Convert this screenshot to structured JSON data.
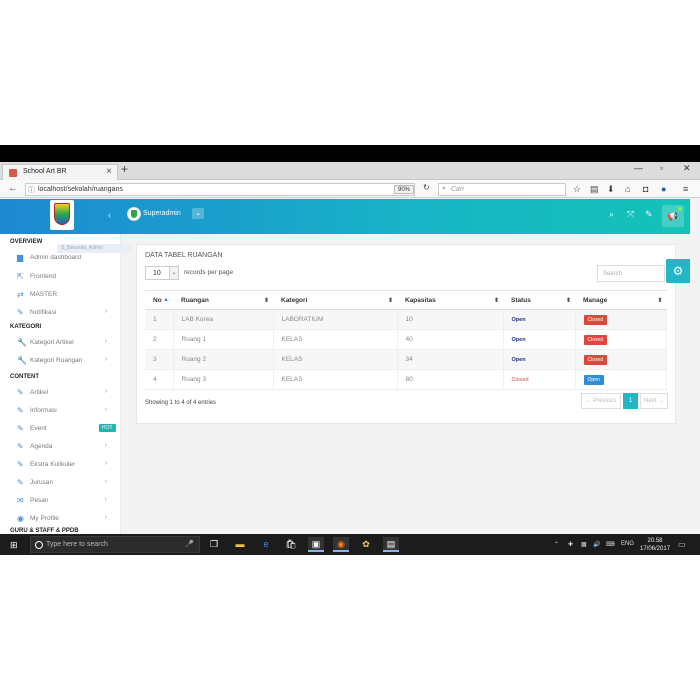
{
  "browser": {
    "tab_title": "School Art BR",
    "tab_close": "×",
    "new_tab": "+",
    "url": "localhost/sekolah/ruangans",
    "zoom": "90%",
    "search_placeholder": "Cari",
    "win_min": "—",
    "win_max": "▫",
    "win_close": "✕"
  },
  "header": {
    "user_name": "Superadmin",
    "collapse_icon": "‹",
    "dropdown_icon": "⌄"
  },
  "sidebar": {
    "ghost_label": "S_Beranda_Admin",
    "sections": [
      {
        "title": "OVERVIEW"
      },
      {
        "title": "KATEGORI"
      },
      {
        "title": "CONTENT"
      },
      {
        "title": "GURU & STAFF & PPDB"
      }
    ],
    "items": [
      {
        "label": "Admin dashboard",
        "icon": "chart-icon",
        "chev": ""
      },
      {
        "label": "Frontend",
        "icon": "external-link-icon",
        "chev": ""
      },
      {
        "label": "MASTER",
        "icon": "arrows-icon",
        "chev": ""
      },
      {
        "label": "Notifikasi",
        "icon": "pencil-icon",
        "chev": "›"
      },
      {
        "label": "Kategori Artikel",
        "icon": "wrench-icon",
        "chev": "›"
      },
      {
        "label": "Kategori Ruangan",
        "icon": "wrench-icon",
        "chev": "›"
      },
      {
        "label": "Artikel",
        "icon": "pencil-icon",
        "chev": "›"
      },
      {
        "label": "Informasi",
        "icon": "pencil-icon",
        "chev": "›"
      },
      {
        "label": "Event",
        "icon": "pencil-icon",
        "chev": "›",
        "badge": "HOT"
      },
      {
        "label": "Agenda",
        "icon": "pencil-icon",
        "chev": "›"
      },
      {
        "label": "Ekstra Kulikuler",
        "icon": "pencil-icon",
        "chev": "›"
      },
      {
        "label": "Jurusan",
        "icon": "pencil-icon",
        "chev": "›"
      },
      {
        "label": "Pesan",
        "icon": "mail-icon",
        "chev": "›"
      },
      {
        "label": "My Profile",
        "icon": "eye-icon",
        "chev": "›"
      }
    ]
  },
  "main": {
    "title": "DATA TABEL RUANGAN",
    "page_length": "10",
    "page_length_suffix": "records per page",
    "search_placeholder": "Search",
    "columns": [
      "No",
      "Ruangan",
      "Kategori",
      "Kapasitas",
      "Status",
      "Manage"
    ],
    "rows": [
      {
        "no": "1",
        "ruangan": "LAB Korea",
        "kategori": "LABORATIUM",
        "kapasitas": "10",
        "status": "Open",
        "manage": "Closed"
      },
      {
        "no": "2",
        "ruangan": "Ruang 1",
        "kategori": "KELAS",
        "kapasitas": "40",
        "status": "Open",
        "manage": "Closed"
      },
      {
        "no": "3",
        "ruangan": "Ruang 2",
        "kategori": "KELAS",
        "kapasitas": "34",
        "status": "Open",
        "manage": "Closed"
      },
      {
        "no": "4",
        "ruangan": "Ruang 3",
        "kategori": "KELAS",
        "kapasitas": "80",
        "status": "Closed",
        "manage": "Open"
      }
    ],
    "info": "Showing 1 to 4 of 4 entries",
    "pager": {
      "prev": "← Previous",
      "page": "1",
      "next": "Next →"
    }
  },
  "taskbar": {
    "search_placeholder": "Type here to search",
    "lang": "ENG",
    "time": "20.58",
    "date": "17/06/2017"
  },
  "colors": {
    "header_start": "#1e88d2",
    "header_end": "#14c3b7",
    "accent": "#21b7c6",
    "closed_red": "#e0463b",
    "open_blue": "#2f8fd6"
  }
}
